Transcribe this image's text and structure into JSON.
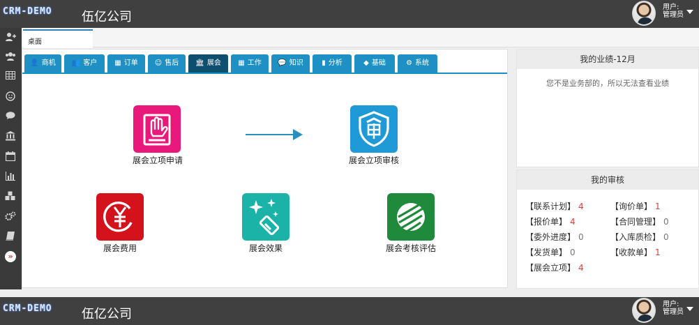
{
  "header": {
    "logo": "CRM-DEMO",
    "company": "伍亿公司",
    "user_label": "用户:",
    "user_role": "管理员"
  },
  "tabs": {
    "desk": "桌面"
  },
  "module_tabs": [
    {
      "label": "商机",
      "icon": "user-plus-icon",
      "glyph": "👤",
      "active": false
    },
    {
      "label": "客户",
      "icon": "users-icon",
      "glyph": "👥",
      "active": false
    },
    {
      "label": "订单",
      "icon": "table-icon",
      "glyph": "▦",
      "active": false
    },
    {
      "label": "售后",
      "icon": "smile-icon",
      "glyph": "☺",
      "active": false
    },
    {
      "label": "展会",
      "icon": "bank-icon",
      "glyph": "🏛",
      "active": true
    },
    {
      "label": "工作",
      "icon": "calendar-icon",
      "glyph": "▦",
      "active": false
    },
    {
      "label": "知识",
      "icon": "comment-icon",
      "glyph": "💬",
      "active": false
    },
    {
      "label": "分析",
      "icon": "bar-chart-icon",
      "glyph": "▮",
      "active": false
    },
    {
      "label": "基础",
      "icon": "cubes-icon",
      "glyph": "◆",
      "active": false
    },
    {
      "label": "系统",
      "icon": "cogs-icon",
      "glyph": "⚙",
      "active": false
    }
  ],
  "workflow": {
    "apply": "展会立项申请",
    "review": "展会立项审核",
    "cost": "展会费用",
    "effect": "展会效果",
    "evaluation": "展会考核评估"
  },
  "performance": {
    "title": "我的业绩-12月",
    "message": "您不是业务部的，所以无法查看业绩"
  },
  "review": {
    "title": "我的审核",
    "items": [
      {
        "label": "【联系计划】",
        "count": "4",
        "highlight": true
      },
      {
        "label": "【询价单】",
        "count": "1",
        "highlight": true
      },
      {
        "label": "【报价单】",
        "count": "4",
        "highlight": true
      },
      {
        "label": "【合同管理】",
        "count": "0",
        "highlight": false
      },
      {
        "label": "【委外进度】",
        "count": "0",
        "highlight": false
      },
      {
        "label": "【入库质检】",
        "count": "0",
        "highlight": false
      },
      {
        "label": "【发货单】",
        "count": "0",
        "highlight": false
      },
      {
        "label": "【收款单】",
        "count": "1",
        "highlight": true
      },
      {
        "label": "【展会立项】",
        "count": "4",
        "highlight": true
      }
    ]
  },
  "colors": {
    "accent": "#1e90c3",
    "active_tab": "#0e4e6e",
    "apply_tile": "#e8197a",
    "review_tile": "#1f9ad6",
    "cost_tile": "#d3121b",
    "effect_tile": "#1bb3a8",
    "evaluation_tile": "#1f8a3c",
    "count_red": "#d9413a"
  }
}
